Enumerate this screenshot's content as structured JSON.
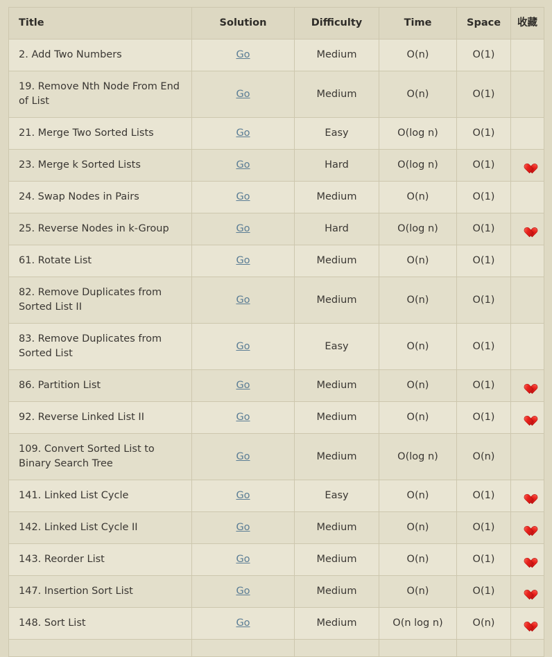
{
  "table": {
    "columns": [
      {
        "key": "title",
        "label": "Title"
      },
      {
        "key": "solution",
        "label": "Solution"
      },
      {
        "key": "difficulty",
        "label": "Difficulty"
      },
      {
        "key": "time",
        "label": "Time"
      },
      {
        "key": "space",
        "label": "Space"
      },
      {
        "key": "favorite",
        "label": "收藏"
      }
    ],
    "link_label": "Go",
    "favorite_icon": "heart-icon",
    "colors": {
      "page_background": "#ded9c3",
      "header_background": "#ddd8c2",
      "row_odd_background": "#e9e5d3",
      "row_even_background": "#e3dfcb",
      "border": "#cdc7ae",
      "text": "#3a3733",
      "link": "#5b7d95",
      "heart": "#e62020"
    },
    "rows": [
      {
        "title": "2. Add Two Numbers",
        "solution": "Go",
        "difficulty": "Medium",
        "time": "O(n)",
        "space": "O(1)",
        "favorite": false
      },
      {
        "title": "19. Remove Nth Node From End of List",
        "solution": "Go",
        "difficulty": "Medium",
        "time": "O(n)",
        "space": "O(1)",
        "favorite": false
      },
      {
        "title": "21. Merge Two Sorted Lists",
        "solution": "Go",
        "difficulty": "Easy",
        "time": "O(log n)",
        "space": "O(1)",
        "favorite": false
      },
      {
        "title": "23. Merge k Sorted Lists",
        "solution": "Go",
        "difficulty": "Hard",
        "time": "O(log n)",
        "space": "O(1)",
        "favorite": true
      },
      {
        "title": "24. Swap Nodes in Pairs",
        "solution": "Go",
        "difficulty": "Medium",
        "time": "O(n)",
        "space": "O(1)",
        "favorite": false
      },
      {
        "title": "25. Reverse Nodes in k-Group",
        "solution": "Go",
        "difficulty": "Hard",
        "time": "O(log n)",
        "space": "O(1)",
        "favorite": true
      },
      {
        "title": "61. Rotate List",
        "solution": "Go",
        "difficulty": "Medium",
        "time": "O(n)",
        "space": "O(1)",
        "favorite": false
      },
      {
        "title": "82. Remove Duplicates from Sorted List II",
        "solution": "Go",
        "difficulty": "Medium",
        "time": "O(n)",
        "space": "O(1)",
        "favorite": false
      },
      {
        "title": "83. Remove Duplicates from Sorted List",
        "solution": "Go",
        "difficulty": "Easy",
        "time": "O(n)",
        "space": "O(1)",
        "favorite": false
      },
      {
        "title": "86. Partition List",
        "solution": "Go",
        "difficulty": "Medium",
        "time": "O(n)",
        "space": "O(1)",
        "favorite": true
      },
      {
        "title": "92. Reverse Linked List II",
        "solution": "Go",
        "difficulty": "Medium",
        "time": "O(n)",
        "space": "O(1)",
        "favorite": true
      },
      {
        "title": "109. Convert Sorted List to Binary Search Tree",
        "solution": "Go",
        "difficulty": "Medium",
        "time": "O(log n)",
        "space": "O(n)",
        "favorite": false
      },
      {
        "title": "141. Linked List Cycle",
        "solution": "Go",
        "difficulty": "Easy",
        "time": "O(n)",
        "space": "O(1)",
        "favorite": true
      },
      {
        "title": "142. Linked List Cycle II",
        "solution": "Go",
        "difficulty": "Medium",
        "time": "O(n)",
        "space": "O(1)",
        "favorite": true
      },
      {
        "title": "143. Reorder List",
        "solution": "Go",
        "difficulty": "Medium",
        "time": "O(n)",
        "space": "O(1)",
        "favorite": true
      },
      {
        "title": "147. Insertion Sort List",
        "solution": "Go",
        "difficulty": "Medium",
        "time": "O(n)",
        "space": "O(1)",
        "favorite": true
      },
      {
        "title": "148. Sort List",
        "solution": "Go",
        "difficulty": "Medium",
        "time": "O(n log n)",
        "space": "O(n)",
        "favorite": true
      },
      {
        "title": "",
        "solution": "",
        "difficulty": "",
        "time": "",
        "space": "",
        "favorite": false
      }
    ]
  }
}
